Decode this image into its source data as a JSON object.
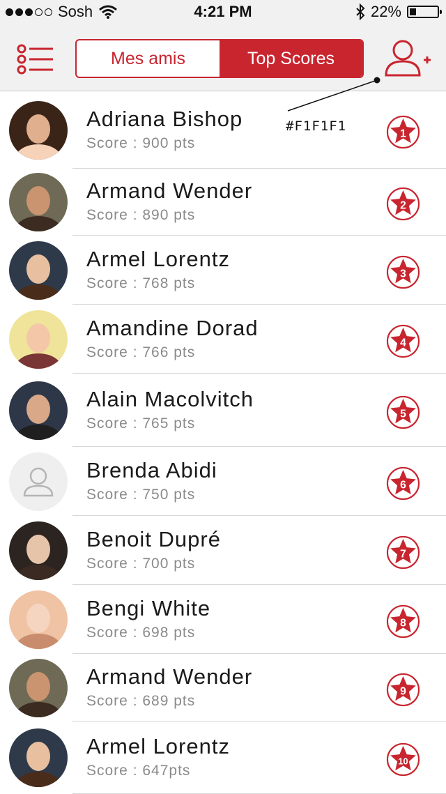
{
  "status": {
    "carrier": "Sosh",
    "time": "4:21 PM",
    "battery": "22%"
  },
  "header": {
    "tabs": [
      {
        "label": "Mes amis",
        "active": false
      },
      {
        "label": "Top Scores",
        "active": true
      }
    ]
  },
  "annotation": "#F1F1F1",
  "colors": {
    "accent": "#c8252f",
    "navbar_bg": "#f1f1f1"
  },
  "players": [
    {
      "name": "Adriana Bishop",
      "score": "Score : 900 pts",
      "rank": "1",
      "avatar": "photo"
    },
    {
      "name": "Armand Wender",
      "score": "Score : 890 pts",
      "rank": "2",
      "avatar": "photo"
    },
    {
      "name": "Armel Lorentz",
      "score": "Score : 768 pts",
      "rank": "3",
      "avatar": "photo"
    },
    {
      "name": "Amandine Dorad",
      "score": "Score : 766 pts",
      "rank": "4",
      "avatar": "photo"
    },
    {
      "name": "Alain Macolvitch",
      "score": "Score : 765 pts",
      "rank": "5",
      "avatar": "photo"
    },
    {
      "name": "Brenda Abidi",
      "score": "Score : 750 pts",
      "rank": "6",
      "avatar": "placeholder"
    },
    {
      "name": "Benoit Dupré",
      "score": "Score : 700 pts",
      "rank": "7",
      "avatar": "photo"
    },
    {
      "name": "Bengi White",
      "score": "Score : 698 pts",
      "rank": "8",
      "avatar": "photo"
    },
    {
      "name": "Armand Wender",
      "score": "Score : 689 pts",
      "rank": "9",
      "avatar": "photo"
    },
    {
      "name": "Armel Lorentz",
      "score": "Score : 647pts",
      "rank": "10",
      "avatar": "photo"
    }
  ]
}
